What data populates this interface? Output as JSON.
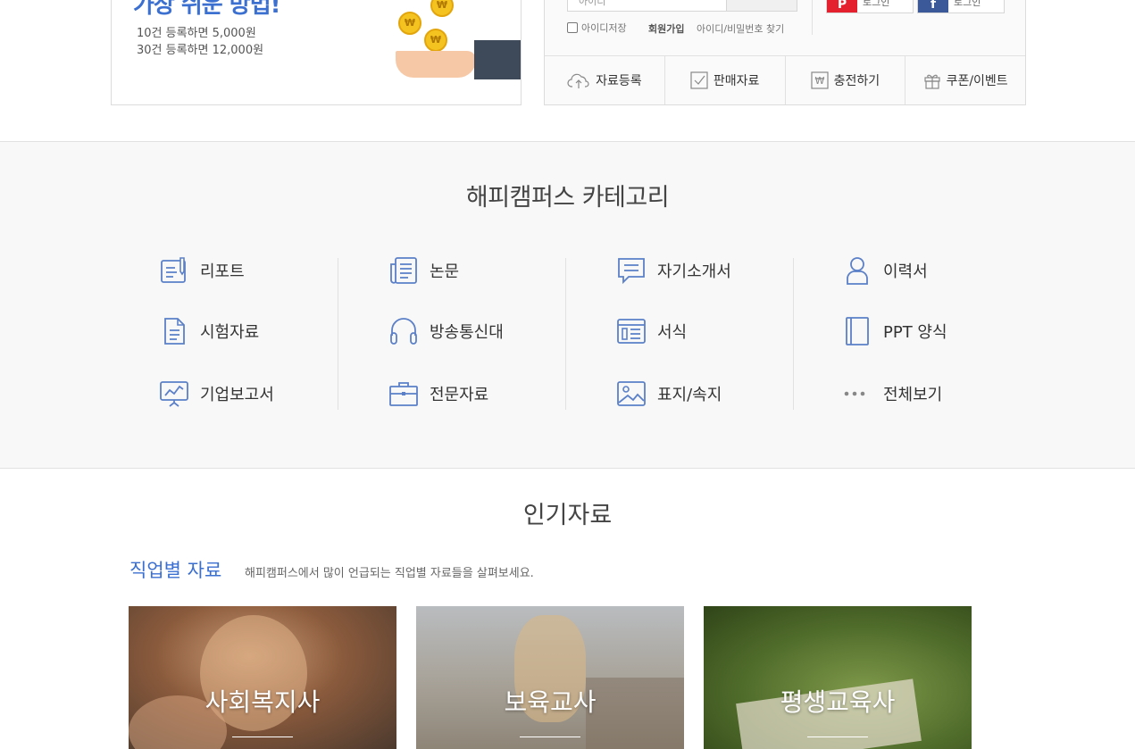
{
  "promo": {
    "title": "가장 쉬운 방법!",
    "line1": "10건 등록하면 5,000원",
    "line2": "30건 등록하면 12,000원",
    "coin_symbol": "₩"
  },
  "login": {
    "id_placeholder": "아이디",
    "save_id": "아이디저장",
    "join": "회원가입",
    "find": "아이디/비밀번호 찾기",
    "sns": [
      {
        "icon": "P",
        "label": "로그인",
        "color": "#e5202e"
      },
      {
        "icon": "f",
        "label": "로그인",
        "color": "#3b5998"
      }
    ]
  },
  "quick_menu": [
    {
      "label": "자료등록",
      "icon": "cloud-upload-icon"
    },
    {
      "label": "판매자료",
      "icon": "checkbox-icon"
    },
    {
      "label": "충전하기",
      "icon": "won-icon"
    },
    {
      "label": "쿠폰/이벤트",
      "icon": "gift-icon"
    }
  ],
  "category": {
    "title": "해피캠퍼스 카테고리",
    "columns": [
      [
        {
          "label": "리포트",
          "icon": "report-icon"
        },
        {
          "label": "시험자료",
          "icon": "document-icon"
        },
        {
          "label": "기업보고서",
          "icon": "presentation-icon"
        }
      ],
      [
        {
          "label": "논문",
          "icon": "newspaper-icon"
        },
        {
          "label": "방송통신대",
          "icon": "headphones-icon"
        },
        {
          "label": "전문자료",
          "icon": "briefcase-icon"
        }
      ],
      [
        {
          "label": "자기소개서",
          "icon": "speech-bubble-icon"
        },
        {
          "label": "서식",
          "icon": "form-icon"
        },
        {
          "label": "표지/속지",
          "icon": "image-icon"
        }
      ],
      [
        {
          "label": "이력서",
          "icon": "person-icon"
        },
        {
          "label": "PPT 양식",
          "icon": "book-icon"
        },
        {
          "label": "전체보기",
          "icon": "more-dots-icon"
        }
      ]
    ]
  },
  "popular": {
    "title": "인기자료",
    "job_title": "직업별 자료",
    "job_desc": "해피캠퍼스에서 많이 언급되는 직업별 자료들을 살펴보세요.",
    "cards": [
      {
        "label": "사회복지사"
      },
      {
        "label": "보육교사"
      },
      {
        "label": "평생교육사"
      }
    ]
  },
  "colors": {
    "accent": "#3b6fd0",
    "icon": "#5b80c8"
  }
}
